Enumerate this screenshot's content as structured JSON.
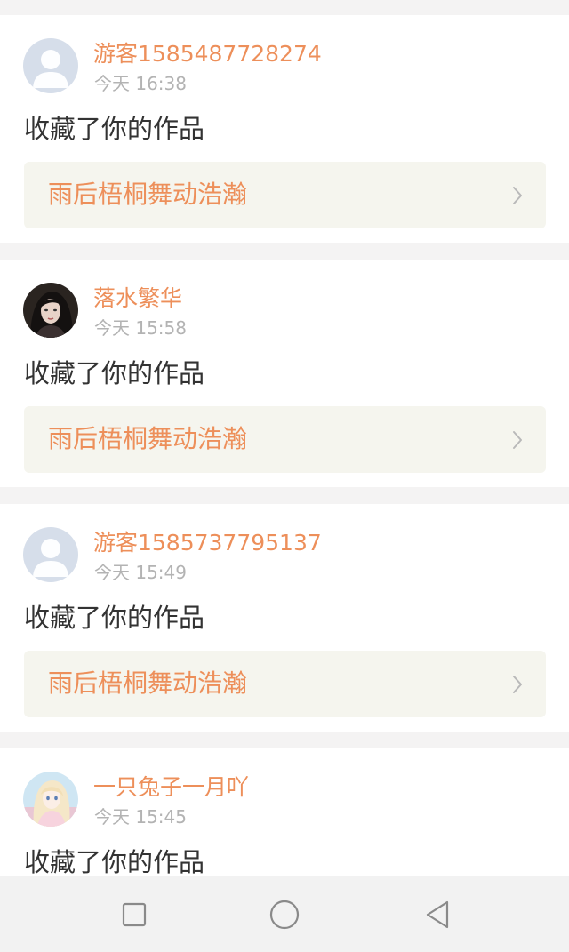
{
  "notifications": [
    {
      "username": "游客1585487728274",
      "time": "今天 16:38",
      "action": "收藏了你的作品",
      "work_title": "雨后梧桐舞动浩瀚",
      "avatar": "default-avatar"
    },
    {
      "username": "落水繁华",
      "time": "今天 15:58",
      "action": "收藏了你的作品",
      "work_title": "雨后梧桐舞动浩瀚",
      "avatar": "photo-avatar-woman"
    },
    {
      "username": "游客1585737795137",
      "time": "今天 15:49",
      "action": "收藏了你的作品",
      "work_title": "雨后梧桐舞动浩瀚",
      "avatar": "default-avatar"
    },
    {
      "username": "一只兔子一月吖",
      "time": "今天 15:45",
      "action": "收藏了你的作品",
      "avatar": "anime-avatar"
    }
  ],
  "nav_bar": {
    "icons": [
      "recent-apps-icon",
      "home-icon",
      "back-icon"
    ]
  },
  "colors": {
    "accent": "#ed8f5a",
    "link_background": "#f5f5ee",
    "page_background": "#f4f3f3"
  }
}
